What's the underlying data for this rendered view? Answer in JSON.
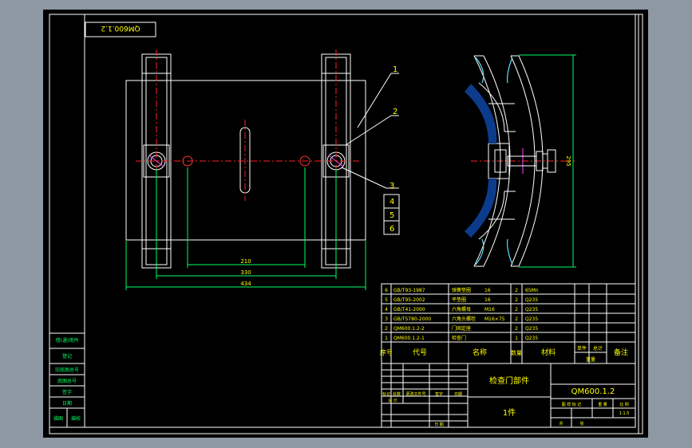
{
  "drawing": {
    "code_box": "QM600.1.2",
    "dim_210": "210",
    "dim_330": "330",
    "dim_434": "434",
    "dim_vertical": "295",
    "leaders": [
      "1",
      "2",
      "3",
      "4",
      "5",
      "6"
    ]
  },
  "bom": {
    "rows": [
      {
        "no": "6",
        "code": "GB/T93-1987",
        "name": "弹簧垫圈",
        "spec": "16",
        "qty": "2",
        "material": "65Mn"
      },
      {
        "no": "5",
        "code": "GB/T95-2002",
        "name": "平垫圈",
        "spec": "16",
        "qty": "2",
        "material": "Q235"
      },
      {
        "no": "4",
        "code": "GB/T41-2000",
        "name": "六角螺母",
        "spec": "M16",
        "qty": "2",
        "material": "Q235"
      },
      {
        "no": "3",
        "code": "GB/T5780-2000",
        "name": "六角头螺栓",
        "spec": "M16×75",
        "qty": "2",
        "material": "Q235"
      },
      {
        "no": "2",
        "code": "QM600.1.2-2",
        "name": "门固定座",
        "spec": "",
        "qty": "2",
        "material": "Q235"
      },
      {
        "no": "1",
        "code": "QM600.1.2-1",
        "name": "检查门",
        "spec": "",
        "qty": "1",
        "material": "Q235"
      }
    ],
    "header": {
      "no": "序号",
      "code": "代号",
      "name": "名称",
      "qty": "数量",
      "material": "材料",
      "unit": "单件",
      "total": "总计",
      "weight": "重量",
      "remark": "备注"
    }
  },
  "title_block": {
    "part_name": "检查门部件",
    "drawing_no": "QM600.1.2",
    "quantity": "1件",
    "sign_row": [
      "标记",
      "处数",
      "更改文件号",
      "签字",
      "日期"
    ],
    "design": "设 计",
    "date_label": "日 期",
    "stage": "图 样 标 记",
    "weight": "重 量",
    "scale": "比 例",
    "scale_value": "1:1.5",
    "sheet": "共",
    "sheet2": "张"
  },
  "side_table": {
    "cells": [
      "借(通)用件",
      "登记",
      "旧底图总号",
      "底图总号",
      "签字",
      "日期",
      "描图",
      "描校"
    ]
  },
  "colors": {
    "page": "#000000",
    "frame": "#ffffff",
    "outline": "#ffffff",
    "center": "#ff0000",
    "dim": "#00ff66",
    "text": "#ffff00",
    "hidden": "#ff00ff"
  }
}
